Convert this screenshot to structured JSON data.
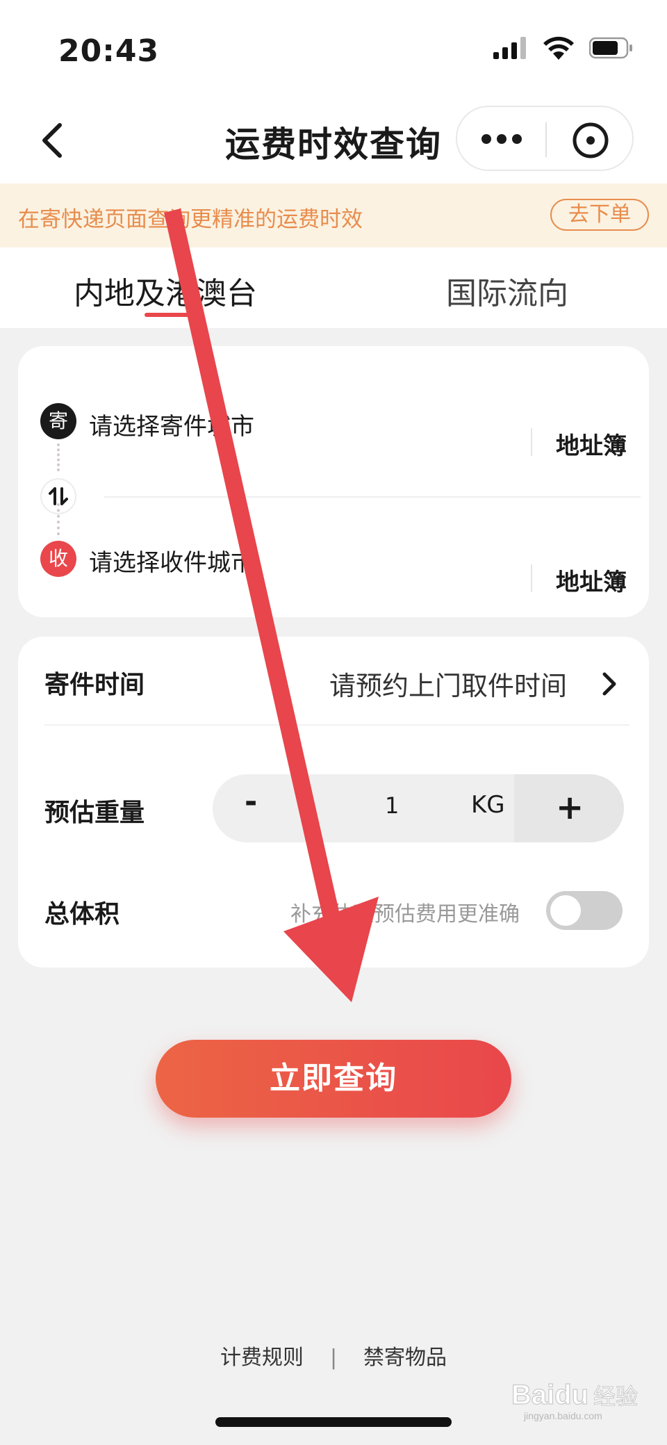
{
  "status_bar": {
    "time": "20:43"
  },
  "nav": {
    "title": "运费时效查询"
  },
  "notice": {
    "text": "在寄快递页面查询更精准的运费时效",
    "button": "去下单"
  },
  "tabs": [
    {
      "label": "内地及港澳台",
      "active": true
    },
    {
      "label": "国际流向",
      "active": false
    }
  ],
  "address": {
    "send_badge": "寄",
    "send_placeholder": "请选择寄件城市",
    "recv_badge": "收",
    "recv_placeholder": "请选择收件城市",
    "address_book": "地址簿"
  },
  "options": {
    "time_label": "寄件时间",
    "time_value": "请预约上门取件时间",
    "weight_label": "预估重量",
    "weight_value": "1",
    "weight_unit": "KG",
    "minus": "-",
    "plus": "+",
    "volume_label": "总体积",
    "volume_hint": "补充体积预估费用更准确",
    "volume_toggle_on": false
  },
  "query_button": "立即查询",
  "footer": {
    "rules": "计费规则",
    "separator": "|",
    "prohibited": "禁寄物品"
  },
  "watermark": {
    "text": "Baidu经验",
    "subtext": "jingyan.baidu.com"
  },
  "colors": {
    "accent": "#e9474b",
    "notice_text": "#e88c4c",
    "notice_bg": "#fbf2e2",
    "background": "#f1f1f1"
  }
}
